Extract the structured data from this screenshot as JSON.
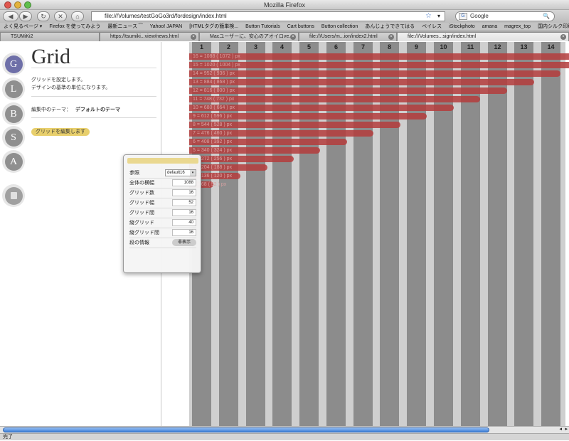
{
  "window": {
    "title": "Mozilla Firefox"
  },
  "nav": {
    "url": "file:///Volumes/testGoGo3rd/fordesign/index.html",
    "search_placeholder": "Google",
    "back_icon": "◀",
    "forward_icon": "▶",
    "reload_icon": "↻",
    "stop_icon": "✕",
    "home_icon": "⌂",
    "star_icon": "☆",
    "dropdown_icon": "▾",
    "search_engine_icon": "G",
    "magnifier_icon": "🔍"
  },
  "bookmarks": [
    "よく見るページ ▾",
    "Firefox を使ってみよう",
    "最新ニュース ⁀",
    "Yahoo! JAPAN",
    "[HTMLタグの簡単検...",
    "Button Tutorials",
    "Cart buttons",
    "Button collection",
    "あんじょうできてはる",
    "ベイレス",
    "iStockphoto",
    "amana",
    "magrex_top",
    "国内シルク印刷用DIC..."
  ],
  "tabs": [
    {
      "label": "TSUMiKi2"
    },
    {
      "label": "https://tsumiki...view/news.html"
    },
    {
      "label": "Macユーザーに、安心のアオイロve..."
    },
    {
      "label": "file:///Users/m...ion/index2.html"
    },
    {
      "label": "file:///Volumes...sign/index.html"
    }
  ],
  "sidebar": {
    "items": [
      "G",
      "L",
      "B",
      "S",
      "A",
      ""
    ]
  },
  "panel": {
    "title": "Grid",
    "desc1": "グリッドを設定します。",
    "desc2": "デザインの基準の単位になります。",
    "theme_label": "編集中のテーマ：",
    "theme_value": "デフォルトのテーマ",
    "edit_button": "グリッドを編集します"
  },
  "popup": {
    "rows": [
      {
        "label": "参照",
        "value": "default16"
      },
      {
        "label": "全体の横幅",
        "value": "1088"
      },
      {
        "label": "グリッド数",
        "value": "16"
      },
      {
        "label": "グリッド幅",
        "value": "52"
      },
      {
        "label": "グリッド間",
        "value": "16"
      },
      {
        "label": "縦グリッド",
        "value": "40"
      },
      {
        "label": "縦グリッド間",
        "value": "16"
      },
      {
        "label": "段の情報",
        "value": "非表示"
      }
    ]
  },
  "grid": {
    "columns": [
      "1",
      "2",
      "3",
      "4",
      "5",
      "6",
      "7",
      "8",
      "9",
      "10",
      "11",
      "12",
      "13",
      "14"
    ],
    "bars": [
      "16 = 1088 ( 1072 ) px",
      "15 = 1020 ( 1004 ) px",
      "14 = 952 ( 936 ) px",
      "13 = 884 ( 868 ) px",
      "12 = 816 ( 800 ) px",
      "11 = 748 ( 732 ) px",
      "10 = 680 ( 664 ) px",
      "9 = 612 ( 596 ) px",
      "8 = 544 ( 528 ) px",
      "7 = 476 ( 460 ) px",
      "6 = 408 ( 392 ) px",
      "5 = 340 ( 324 ) px",
      "4 = 272 ( 256 ) px",
      "3 = 204 ( 188 ) px",
      "2 = 136 ( 120 ) px",
      "1 = 68 ( 52 ) px"
    ]
  },
  "status": {
    "text": "完了"
  },
  "colors": {
    "accent": "#6e6fa8",
    "bar": "#b43c3c",
    "button": "#e8cf6c",
    "column": "#8c8c8c"
  }
}
